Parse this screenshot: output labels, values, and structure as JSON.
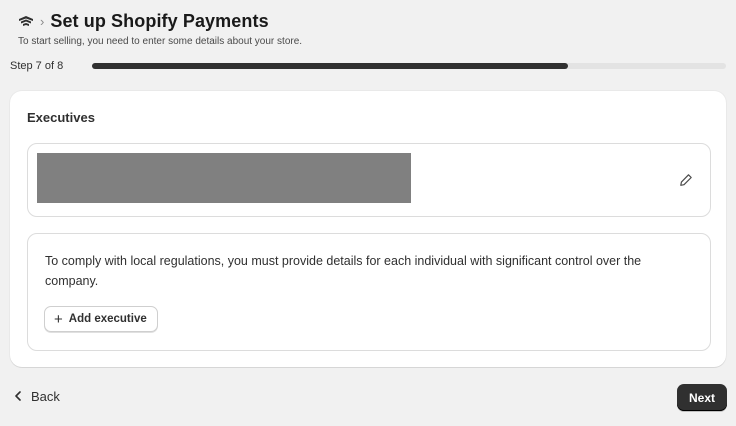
{
  "header": {
    "app_icon": "shopify-payments-icon",
    "breadcrumb_separator": "›",
    "title": "Set up Shopify Payments",
    "subtitle": "To start selling, you need to enter some details about your store."
  },
  "progress": {
    "label": "Step 7 of 8",
    "current_step": 7,
    "total_steps": 8,
    "fill_fraction": 0.75
  },
  "card": {
    "title": "Executives",
    "executive_entry": {
      "name": "",
      "redacted": true,
      "edit_icon": "pencil-icon"
    },
    "info": {
      "text": "To comply with local regulations, you must provide details for each individual with significant control over the company.",
      "add_button_icon": "plus-icon",
      "add_button_label": "Add executive"
    }
  },
  "footer": {
    "back_icon": "chevron-left-icon",
    "back_label": "Back",
    "next_label": "Next"
  },
  "colors": {
    "background": "#f1f1f1",
    "card": "#ffffff",
    "primary_button": "#303030",
    "progress_fill": "#303030",
    "progress_track": "#e3e3e3",
    "redaction": "#808080"
  }
}
